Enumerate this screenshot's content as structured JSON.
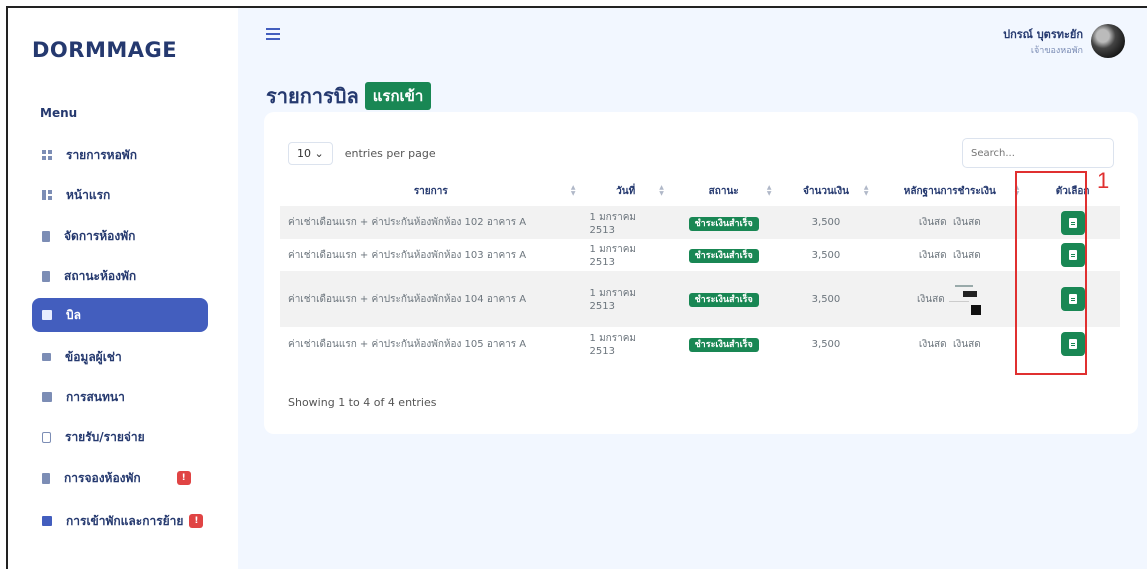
{
  "sidebar": {
    "logo": "DORMMAGE",
    "menu_title": "Menu",
    "items": [
      {
        "label": "รายการหอพัก",
        "icon": "grid-icon"
      },
      {
        "label": "หน้าแรก",
        "icon": "dashboard-icon"
      },
      {
        "label": "จัดการห้องพัก",
        "icon": "building-icon"
      },
      {
        "label": "สถานะห้องพัก",
        "icon": "building-status-icon"
      },
      {
        "label": "บิล",
        "icon": "receipt-icon",
        "active": true
      },
      {
        "label": "ข้อมูลผู้เช่า",
        "icon": "people-icon"
      },
      {
        "label": "การสนทนา",
        "icon": "chat-icon"
      },
      {
        "label": "รายรับ/รายจ่าย",
        "icon": "wallet-icon"
      },
      {
        "label": "การจองห้องพัก",
        "icon": "bookmark-icon",
        "badge": "!"
      },
      {
        "label": "การเข้าพักและการย้าย",
        "icon": "move-icon",
        "badge": "!"
      }
    ]
  },
  "header": {
    "user_name": "ปกรณ์ บุตรทะยัก",
    "user_role": "เจ้าของหอพัก"
  },
  "page": {
    "title": "รายการบิล",
    "title_badge": "แรกเข้า"
  },
  "table": {
    "length_value": "10",
    "length_label": "entries per page",
    "search_placeholder": "Search...",
    "columns": [
      "รายการ",
      "วันที่",
      "สถานะ",
      "จำนวนเงิน",
      "หลักฐานการชำระเงิน",
      "ตัวเลือก"
    ],
    "rows": [
      {
        "item": "ค่าเช่าเดือนแรก + ค่าประกันห้องพักห้อง 102 อาคาร A",
        "date": "1 มกราคม 2513",
        "status": "ชำระเงินสำเร็จ",
        "amount": "3,500",
        "proof1": "เงินสด",
        "proof2": "เงินสด"
      },
      {
        "item": "ค่าเช่าเดือนแรก + ค่าประกันห้องพักห้อง 103 อาคาร A",
        "date": "1 มกราคม 2513",
        "status": "ชำระเงินสำเร็จ",
        "amount": "3,500",
        "proof1": "เงินสด",
        "proof2": "เงินสด"
      },
      {
        "item": "ค่าเช่าเดือนแรก + ค่าประกันห้องพักห้อง 104 อาคาร A",
        "date": "1 มกราคม 2513",
        "status": "ชำระเงินสำเร็จ",
        "amount": "3,500",
        "proof1": "เงินสด",
        "proof2": ""
      },
      {
        "item": "ค่าเช่าเดือนแรก + ค่าประกันห้องพักห้อง 105 อาคาร A",
        "date": "1 มกราคม 2513",
        "status": "ชำระเงินสำเร็จ",
        "amount": "3,500",
        "proof1": "เงินสด",
        "proof2": "เงินสด"
      }
    ],
    "info": "Showing 1 to 4 of 4 entries"
  },
  "annotation": {
    "number": "1"
  },
  "colors": {
    "primary": "#435ebe",
    "success": "#198754",
    "danger": "#e04444",
    "annotation": "#e03030"
  }
}
